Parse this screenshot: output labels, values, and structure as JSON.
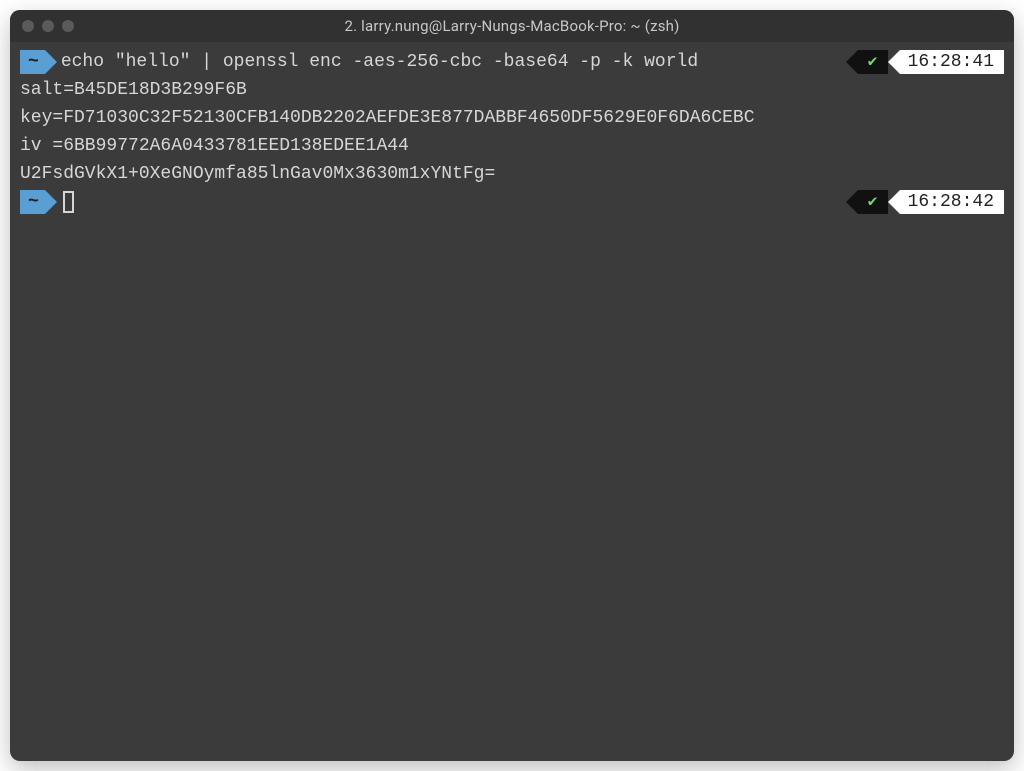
{
  "window": {
    "title": "2. larry.nung@Larry-Nungs-MacBook-Pro: ~ (zsh)"
  },
  "prompt1": {
    "dir": "~",
    "command": "echo \"hello\" | openssl enc -aes-256-cbc -base64 -p -k world",
    "status_icon": "✔",
    "time": "16:28:41"
  },
  "output": {
    "salt": "salt=B45DE18D3B299F6B",
    "key": "key=FD71030C32F52130CFB140DB2202AEFDE3E877DABBF4650DF5629E0F6DA6CEBC",
    "iv": "iv =6BB99772A6A0433781EED138EDEE1A44",
    "cipher": "U2FsdGVkX1+0XeGNOymfa85lnGav0Mx3630m1xYNtFg="
  },
  "prompt2": {
    "dir": "~",
    "status_icon": "✔",
    "time": "16:28:42"
  }
}
